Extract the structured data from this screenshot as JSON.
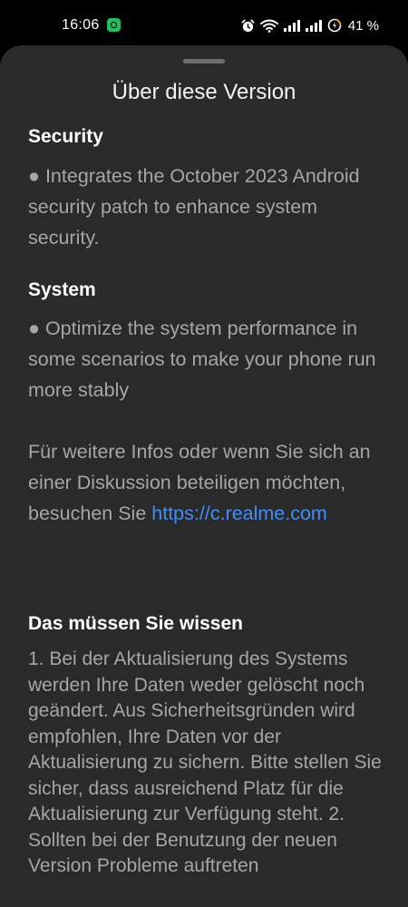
{
  "status_bar": {
    "time": "16:06",
    "battery_percent": "41 %",
    "icons": [
      "whatsapp-notification-icon",
      "alarm-icon",
      "wifi-icon",
      "signal-icon",
      "signal-icon-2",
      "battery-icon"
    ]
  },
  "sheet": {
    "title": "Über diese Version",
    "sections": [
      {
        "heading": "Security",
        "body": "● Integrates the October 2023 Android security patch to enhance system security."
      },
      {
        "heading": "System",
        "body": "● Optimize the system performance in some scenarios to make your phone run more stably"
      }
    ],
    "more_info": {
      "text": "Für weitere Infos oder wenn Sie sich an einer Diskussion beteiligen möchten, besuchen Sie",
      "link": "https://c.realme.com"
    },
    "notice": {
      "heading": "Das müssen Sie wissen",
      "body": "1. Bei der Aktualisierung des Systems werden Ihre Daten weder gelöscht noch geändert. Aus Sicherheitsgründen wird empfohlen, Ihre Daten vor der Aktualisierung zu sichern. Bitte stellen Sie sicher, dass ausreichend Platz für die Aktualisierung zur Verfügung steht. 2. Sollten bei der Benutzung der neuen Version Probleme auftreten"
    }
  },
  "colors": {
    "background": "#2a2a2a",
    "heading": "#ffffff",
    "body": "#a6a6a6",
    "link": "#3f8ff7"
  }
}
